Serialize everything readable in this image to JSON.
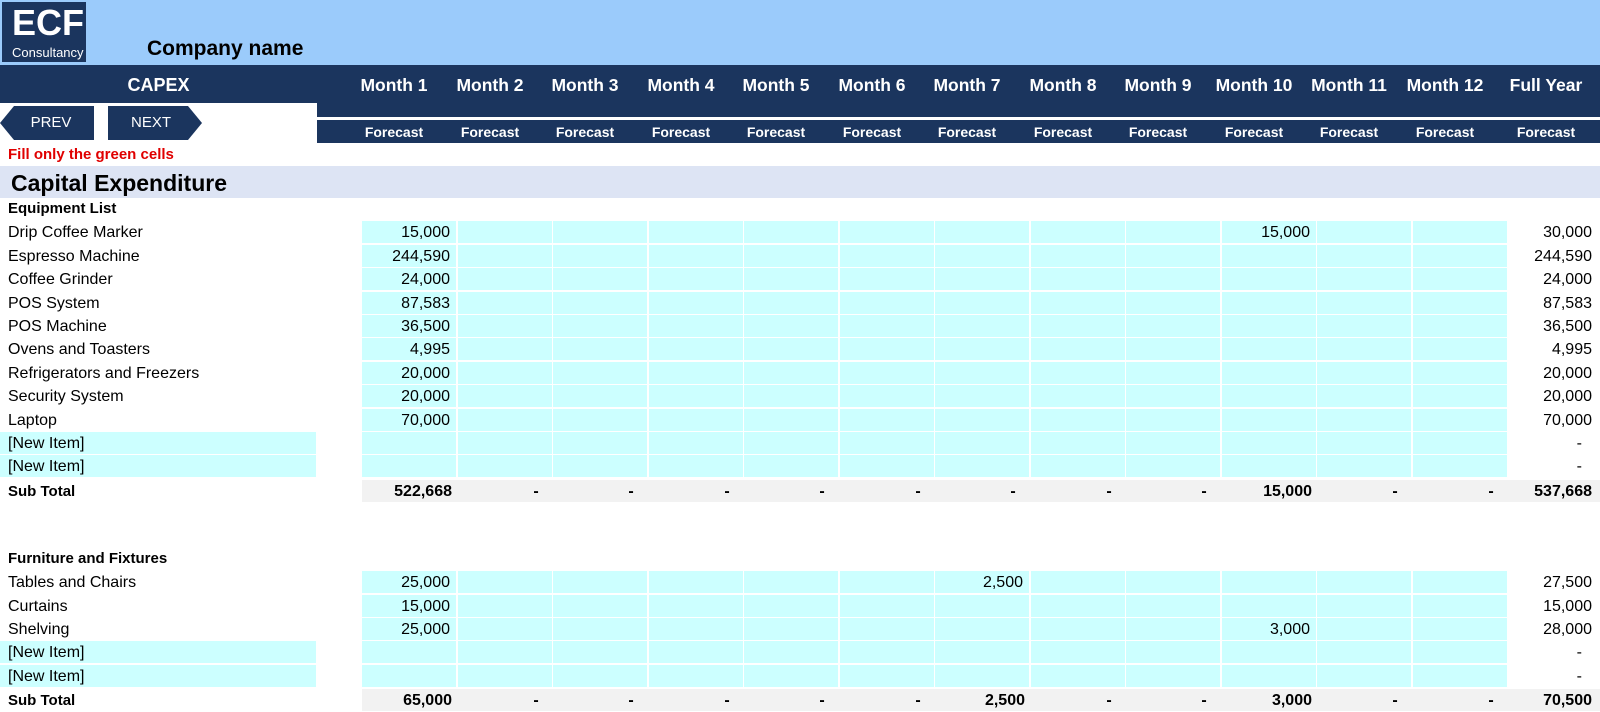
{
  "company": {
    "logo_big": "ECF",
    "logo_small": "Consultancy",
    "name": "Company name"
  },
  "header": {
    "capex_label": "CAPEX",
    "prev_label": "PREV",
    "next_label": "NEXT",
    "months": [
      "Month 1",
      "Month 2",
      "Month 3",
      "Month 4",
      "Month 5",
      "Month 6",
      "Month 7",
      "Month 8",
      "Month 9",
      "Month 10",
      "Month 11",
      "Month 12",
      "Full Year"
    ],
    "forecast_label": "Forecast"
  },
  "note": "Fill only the green cells",
  "section_title": "Capital Expenditure",
  "groups": [
    {
      "title": "Equipment List",
      "rows": [
        {
          "label": "Drip Coffee Marker",
          "values": [
            "15,000",
            "",
            "",
            "",
            "",
            "",
            "",
            "",
            "",
            "15,000",
            "",
            ""
          ],
          "total": "30,000"
        },
        {
          "label": "Espresso Machine",
          "values": [
            "244,590",
            "",
            "",
            "",
            "",
            "",
            "",
            "",
            "",
            "",
            "",
            ""
          ],
          "total": "244,590"
        },
        {
          "label": "Coffee Grinder",
          "values": [
            "24,000",
            "",
            "",
            "",
            "",
            "",
            "",
            "",
            "",
            "",
            "",
            ""
          ],
          "total": "24,000"
        },
        {
          "label": "POS System",
          "values": [
            "87,583",
            "",
            "",
            "",
            "",
            "",
            "",
            "",
            "",
            "",
            "",
            ""
          ],
          "total": "87,583"
        },
        {
          "label": "POS Machine",
          "values": [
            "36,500",
            "",
            "",
            "",
            "",
            "",
            "",
            "",
            "",
            "",
            "",
            ""
          ],
          "total": "36,500"
        },
        {
          "label": "Ovens and Toasters",
          "values": [
            "4,995",
            "",
            "",
            "",
            "",
            "",
            "",
            "",
            "",
            "",
            "",
            ""
          ],
          "total": "4,995"
        },
        {
          "label": "Refrigerators and Freezers",
          "values": [
            "20,000",
            "",
            "",
            "",
            "",
            "",
            "",
            "",
            "",
            "",
            "",
            ""
          ],
          "total": "20,000"
        },
        {
          "label": "Security System",
          "values": [
            "20,000",
            "",
            "",
            "",
            "",
            "",
            "",
            "",
            "",
            "",
            "",
            ""
          ],
          "total": "20,000"
        },
        {
          "label": "Laptop",
          "values": [
            "70,000",
            "",
            "",
            "",
            "",
            "",
            "",
            "",
            "",
            "",
            "",
            ""
          ],
          "total": "70,000"
        },
        {
          "label": "[New Item]",
          "values": [
            "",
            "",
            "",
            "",
            "",
            "",
            "",
            "",
            "",
            "",
            "",
            ""
          ],
          "total": "-"
        },
        {
          "label": "[New Item]",
          "values": [
            "",
            "",
            "",
            "",
            "",
            "",
            "",
            "",
            "",
            "",
            "",
            ""
          ],
          "total": "-"
        }
      ],
      "subtotal": {
        "label": "Sub Total",
        "values": [
          "522,668",
          "-",
          "-",
          "-",
          "-",
          "-",
          "-",
          "-",
          "-",
          "15,000",
          "-",
          "-"
        ],
        "total": "537,668"
      }
    },
    {
      "title": "Furniture and Fixtures",
      "rows": [
        {
          "label": "Tables and Chairs",
          "values": [
            "25,000",
            "",
            "",
            "",
            "",
            "",
            "2,500",
            "",
            "",
            "",
            "",
            ""
          ],
          "total": "27,500"
        },
        {
          "label": "Curtains",
          "values": [
            "15,000",
            "",
            "",
            "",
            "",
            "",
            "",
            "",
            "",
            "",
            "",
            ""
          ],
          "total": "15,000"
        },
        {
          "label": "Shelving",
          "values": [
            "25,000",
            "",
            "",
            "",
            "",
            "",
            "",
            "",
            "",
            "3,000",
            "",
            ""
          ],
          "total": "28,000"
        },
        {
          "label": "[New Item]",
          "values": [
            "",
            "",
            "",
            "",
            "",
            "",
            "",
            "",
            "",
            "",
            "",
            ""
          ],
          "total": "-"
        },
        {
          "label": "[New Item]",
          "values": [
            "",
            "",
            "",
            "",
            "",
            "",
            "",
            "",
            "",
            "",
            "",
            ""
          ],
          "total": "-"
        }
      ],
      "subtotal": {
        "label": "Sub Total",
        "values": [
          "65,000",
          "-",
          "-",
          "-",
          "-",
          "-",
          "2,500",
          "-",
          "-",
          "3,000",
          "-",
          "-"
        ],
        "total": "70,500"
      }
    }
  ]
}
